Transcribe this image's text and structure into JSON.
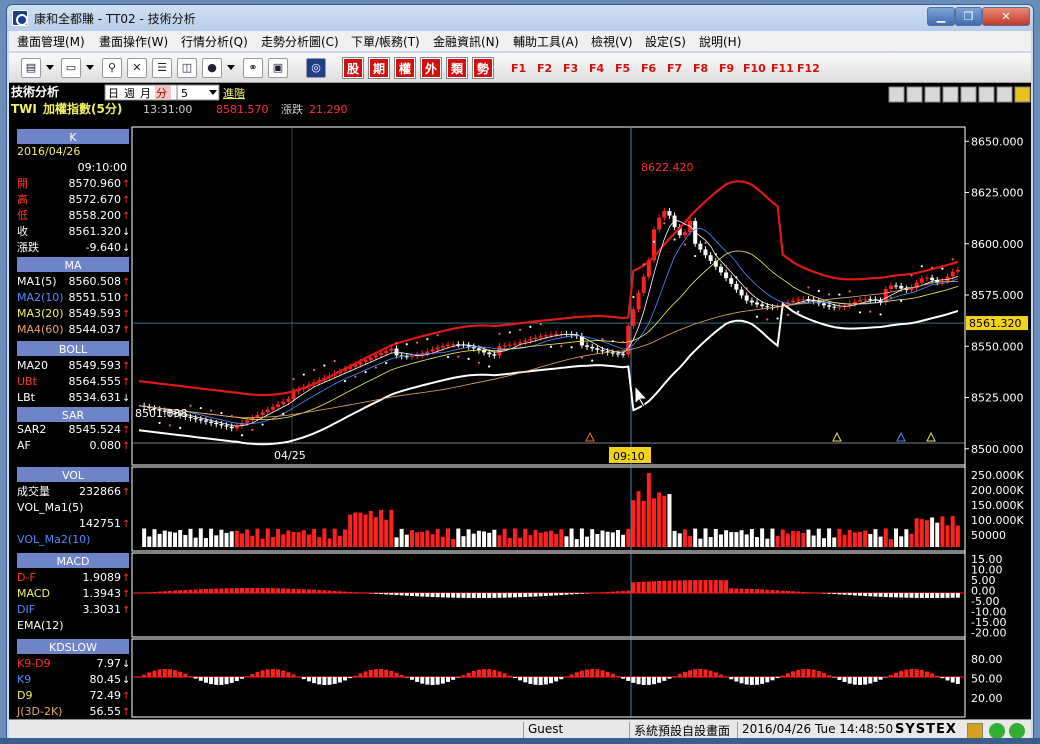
{
  "window": {
    "title": "康和全都賺 - TT02 - 技術分析",
    "min_label": "▁",
    "max_label": "❐",
    "close_label": "✕"
  },
  "menu": [
    "畫面管理(M)",
    "畫面操作(W)",
    "行情分析(Q)",
    "走勢分析圖(C)",
    "下單/帳務(T)",
    "金融資訊(N)",
    "輔助工具(A)",
    "檢視(V)",
    "設定(S)",
    "說明(H)"
  ],
  "toolbar": {
    "red_buttons": [
      "股",
      "期",
      "權",
      "外",
      "類",
      "勢"
    ],
    "function_keys": [
      "F1",
      "F2",
      "F3",
      "F4",
      "F5",
      "F6",
      "F7",
      "F8",
      "F9",
      "F10",
      "F11",
      "F12"
    ]
  },
  "header": {
    "title": "技術分析",
    "periods": [
      "日",
      "週",
      "月",
      "分"
    ],
    "interval": "5",
    "advanced": "進階",
    "symbol": "TWI",
    "symbol_name": "加權指數(5分)",
    "time": "13:31:00",
    "price": "8581.570",
    "change_label": "漲跌",
    "change": "21.290"
  },
  "panel": {
    "k_header": "K",
    "date": "2016/04/26",
    "time": "09:10:00",
    "rows": [
      {
        "label": "開",
        "value": "8570.960",
        "arrow": "↑",
        "color": "#ff3030"
      },
      {
        "label": "高",
        "value": "8572.670",
        "arrow": "↑",
        "color": "#ff3030"
      },
      {
        "label": "低",
        "value": "8558.200",
        "arrow": "↑",
        "color": "#ff3030"
      },
      {
        "label": "收",
        "value": "8561.320",
        "arrow": "↓",
        "color": "#ffffff"
      },
      {
        "label": "漲跌",
        "value": "-9.640",
        "arrow": "↓",
        "color": "#ffffff"
      }
    ],
    "ma_header": "MA",
    "ma_rows": [
      {
        "label": "MA1(5)",
        "value": "8560.508",
        "arrow": "↑",
        "color": "#ffffff"
      },
      {
        "label": "MA2(10)",
        "value": "8551.510",
        "arrow": "↑",
        "color": "#4d8cff"
      },
      {
        "label": "MA3(20)",
        "value": "8549.593",
        "arrow": "↑",
        "color": "#f0f060"
      },
      {
        "label": "MA4(60)",
        "value": "8544.037",
        "arrow": "↑",
        "color": "#e8a860"
      }
    ],
    "boll_header": "BOLL",
    "boll_rows": [
      {
        "label": "MA20",
        "value": "8549.593",
        "arrow": "↑",
        "color": "#ffffff"
      },
      {
        "label": "UBt",
        "value": "8564.555",
        "arrow": "↑",
        "color": "#ff3030"
      },
      {
        "label": "LBt",
        "value": "8534.631",
        "arrow": "↓",
        "color": "#ffffff"
      }
    ],
    "sar_header": "SAR",
    "sar_rows": [
      {
        "label": "SAR2",
        "value": "8545.524",
        "arrow": "↑",
        "color": "#ffffff"
      },
      {
        "label": "AF",
        "value": "0.080",
        "arrow": "↑",
        "color": "#ffffff"
      }
    ],
    "vol_header": "VOL",
    "vol_rows": [
      {
        "label": "成交量",
        "value": "232866",
        "arrow": "↑",
        "color": "#ffffff"
      },
      {
        "label": "VOL_Ma1(5)",
        "value": "",
        "arrow": "",
        "color": "#ffffff"
      },
      {
        "label": "",
        "value": "142751",
        "arrow": "↑",
        "color": "#ffffff"
      },
      {
        "label": "VOL_Ma2(10)",
        "value": "",
        "arrow": "",
        "color": "#4d8cff"
      }
    ],
    "macd_header": "MACD",
    "macd_rows": [
      {
        "label": "D-F",
        "value": "1.9089",
        "arrow": "↑",
        "color": "#ff3030"
      },
      {
        "label": "MACD",
        "value": "1.3943",
        "arrow": "↑",
        "color": "#f0f060"
      },
      {
        "label": "DIF",
        "value": "3.3031",
        "arrow": "↑",
        "color": "#4d8cff"
      },
      {
        "label": "EMA(12)",
        "value": "",
        "arrow": "",
        "color": "#ffffff"
      }
    ],
    "kd_header": "KDSLOW",
    "kd_rows": [
      {
        "label": "K9-D9",
        "value": "7.97",
        "arrow": "↓",
        "color": "#ff3030"
      },
      {
        "label": "K9",
        "value": "80.45",
        "arrow": "↓",
        "color": "#4d8cff"
      },
      {
        "label": "D9",
        "value": "72.49",
        "arrow": "↑",
        "color": "#f0f060"
      },
      {
        "label": "J(3D-2K)",
        "value": "56.55",
        "arrow": "↑",
        "color": "#e8a860"
      }
    ]
  },
  "chart": {
    "price_axis": [
      "8650.000",
      "8625.000",
      "8600.000",
      "8575.000",
      "8550.000",
      "8525.000",
      "8500.000"
    ],
    "price_marker": "8561.320",
    "high_label": "8622.420",
    "low_label": "8501.038",
    "date_label": "04/25",
    "cursor_label": "09:10",
    "vol_axis": [
      "250.000K",
      "200.000K",
      "150.000K",
      "100.000K",
      "50000"
    ],
    "macd_axis": [
      "15.00",
      "10.00",
      "5.00",
      "0.00",
      "-5.00",
      "-10.00",
      "-15.00",
      "-20.00"
    ],
    "kd_axis": [
      "80.00",
      "50.00",
      "20.00"
    ]
  },
  "status": {
    "user": "Guest",
    "layout": "系統預設自設畫面",
    "datetime": "2016/04/26 Tue 14:48:50",
    "brand": "SYSTEX"
  }
}
